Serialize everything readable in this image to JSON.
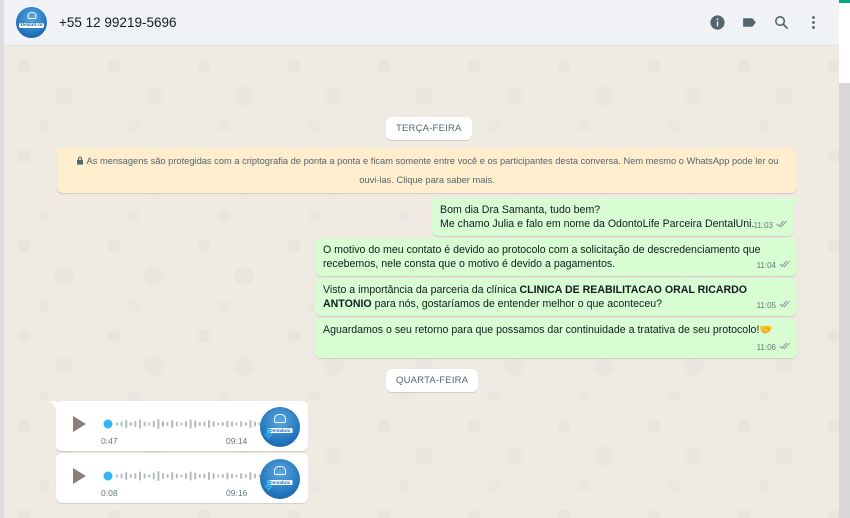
{
  "header": {
    "contact_name": "+55 12 99219-5696",
    "avatar_text": "DentalUni",
    "icons": [
      "info-icon",
      "label-icon",
      "search-icon",
      "menu-icon"
    ]
  },
  "dates": {
    "first": "TERÇA-FEIRA",
    "second": "QUARTA-FEIRA"
  },
  "encryption_notice": "As mensagens são protegidas com a criptografia de ponta a ponta e ficam somente entre você e os participantes desta conversa. Nem mesmo o WhatsApp pode ler ou ouvi-las. Clique para saber mais.",
  "messages": [
    {
      "line1": "Bom dia Dra Samanta, tudo bem?",
      "line2": "Me chamo Julia e falo em nome da OdontoLife Parceira DentalUni.",
      "time": "11:03"
    },
    {
      "text": "O motivo do meu contato é devido ao protocolo com a solicitação de descredenciamento que recebemos, nele consta que o motivo é devido a pagamentos.",
      "time": "11:04"
    },
    {
      "text_pre": "Visto a importância da parceria da clínica ",
      "text_bold": "CLINICA DE REABILITACAO ORAL RICARDO ANTONIO",
      "text_post": " para nós, gostaríamos de entender melhor o que aconteceu?",
      "time": "11:05"
    },
    {
      "text": "Aguardamos o seu retorno para que possamos dar continuidade a tratativa de seu protocolo!",
      "emoji": "🤝",
      "time": "11:06"
    }
  ],
  "voice_notes": [
    {
      "duration": "0:47",
      "time": "09:14"
    },
    {
      "duration": "0:08",
      "time": "09:16"
    }
  ],
  "colors": {
    "accent": "#00a884",
    "outgoing_bubble": "#d9fdd3",
    "notice_bg": "#ffeecd",
    "wave_dot": "#34b7f1"
  }
}
